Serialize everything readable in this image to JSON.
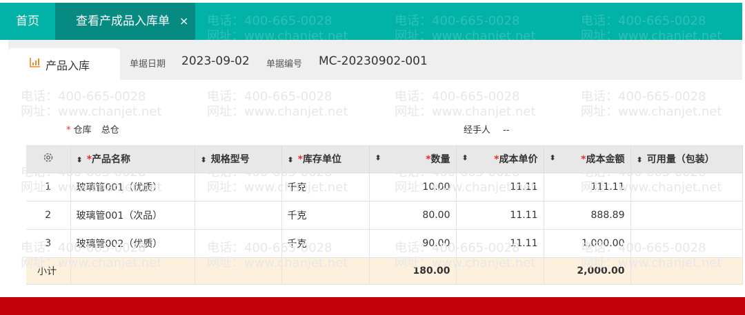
{
  "tabs": {
    "home": "首页",
    "active": "查看产成品入库单",
    "close": "×"
  },
  "doc": {
    "tab_label": "产品入库",
    "date_label": "单据日期",
    "date_value": "2023-09-02",
    "number_label": "单据编号",
    "number_value": "MC-20230902-001"
  },
  "fields": {
    "warehouse_required": "*",
    "warehouse_label": "仓库",
    "warehouse_value": "总仓",
    "handler_label": "经手人",
    "handler_value": "--"
  },
  "table": {
    "headers": {
      "product_name": "产品名称",
      "spec": "规格型号",
      "unit": "库存单位",
      "quantity": "数量",
      "unit_cost": "成本单价",
      "amount": "成本金额",
      "available": "可用量（包装）"
    },
    "required_mark": "*",
    "rows": [
      {
        "index": "1",
        "name": "玻璃管001（优质）",
        "spec": "",
        "unit": "千克",
        "quantity": "10.00",
        "unit_cost": "11.11",
        "amount": "111.11",
        "available": ""
      },
      {
        "index": "2",
        "name": "玻璃管001（次品）",
        "spec": "",
        "unit": "千克",
        "quantity": "80.00",
        "unit_cost": "11.11",
        "amount": "888.89",
        "available": ""
      },
      {
        "index": "3",
        "name": "玻璃管002（优质）",
        "spec": "",
        "unit": "千克",
        "quantity": "90.00",
        "unit_cost": "11.11",
        "amount": "1,000.00",
        "available": ""
      }
    ],
    "subtotal": {
      "label": "小计",
      "quantity": "180.00",
      "amount": "2,000.00"
    }
  },
  "watermark": {
    "phone": "电话：400-665-0028",
    "site": "网址：www.chanjet.net"
  },
  "colors": {
    "topbar": "#00b3a6",
    "active_tab": "#078a82",
    "bottom_bar": "#c00006",
    "required": "#e0332b",
    "subtotal_bg": "#fdf1de"
  }
}
